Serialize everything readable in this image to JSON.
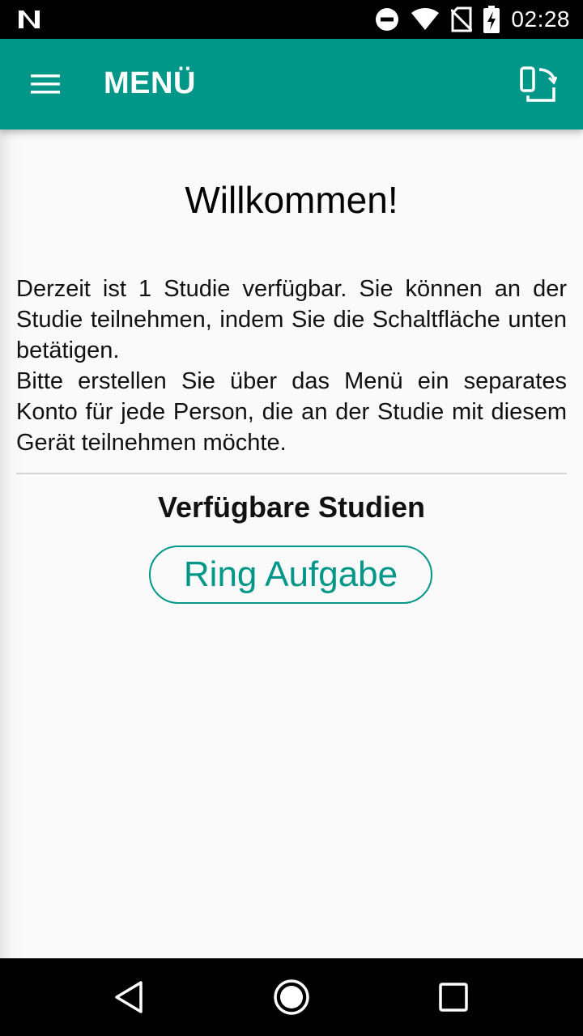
{
  "status_bar": {
    "time": "02:28",
    "icons": [
      "notification-n-icon",
      "do-not-disturb-icon",
      "wifi-icon",
      "no-sim-icon",
      "battery-charging-icon"
    ]
  },
  "app_bar": {
    "title": "MENÜ",
    "menu_icon": "hamburger-menu-icon",
    "action_icon": "device-sync-icon",
    "color": "#009688"
  },
  "main": {
    "welcome": "Willkommen!",
    "intro_paragraph_1": "Derzeit ist 1 Studie verfügbar. Sie können an der Studie teilnehmen, indem Sie die Schaltfläche unten betätigen.",
    "intro_paragraph_2": "Bitte erstellen Sie über das Menü ein separates Konto für jede Person, die an der Studie mit diesem Gerät teilnehmen möchte.",
    "section_title": "Verfügbare Studien",
    "studies": [
      {
        "label": "Ring Aufgabe"
      }
    ]
  },
  "nav_bar": {
    "buttons": [
      "back-icon",
      "home-icon",
      "recents-icon"
    ]
  },
  "colors": {
    "accent": "#009688",
    "background": "#fafafa",
    "text": "#111111"
  }
}
